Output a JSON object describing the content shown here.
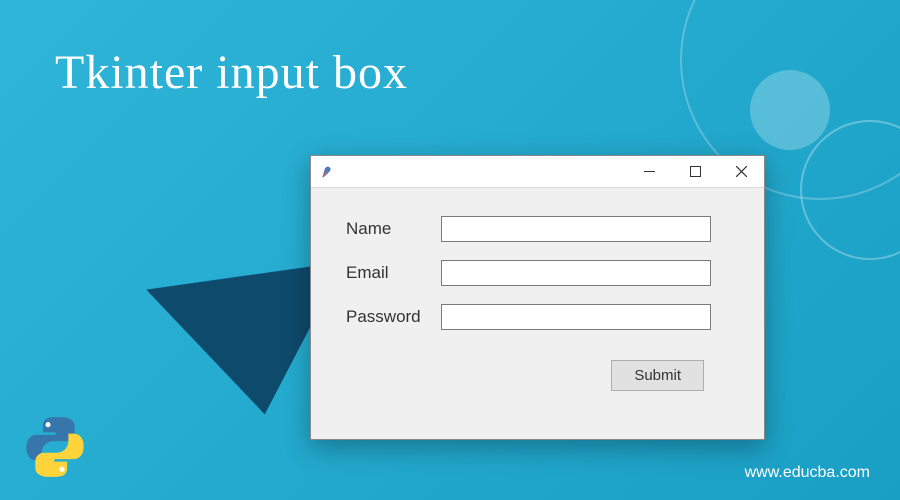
{
  "heading": "Tkinter input box",
  "window": {
    "form": {
      "fields": [
        {
          "label": "Name",
          "value": ""
        },
        {
          "label": "Email",
          "value": ""
        },
        {
          "label": "Password",
          "value": ""
        }
      ],
      "submit_label": "Submit"
    }
  },
  "website_url": "www.educba.com",
  "colors": {
    "background_start": "#2eb5d8",
    "background_end": "#1a9fc4",
    "shadow": "#0e4a6b",
    "window_bg": "#f0f0f0",
    "button_bg": "#e1e1e1"
  }
}
